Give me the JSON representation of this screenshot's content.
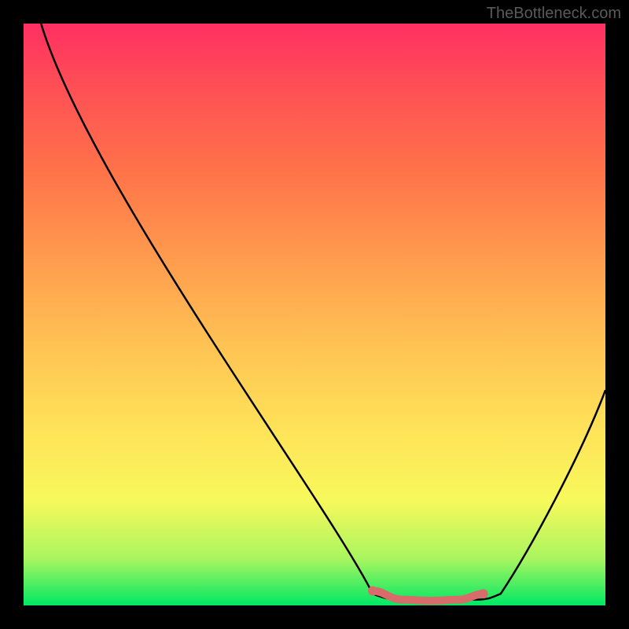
{
  "watermark": "TheBottleneck.com",
  "chart_data": {
    "type": "line",
    "title": "",
    "xlabel": "",
    "ylabel": "",
    "xlim": [
      0,
      1
    ],
    "ylim": [
      0,
      1
    ],
    "series": [
      {
        "name": "main-curve",
        "points": [
          {
            "x": 0.03,
            "y": 1.0
          },
          {
            "x": 0.6,
            "y": 0.02
          },
          {
            "x": 0.65,
            "y": 0.01
          },
          {
            "x": 0.78,
            "y": 0.01
          },
          {
            "x": 0.82,
            "y": 0.02
          },
          {
            "x": 1.0,
            "y": 0.37
          }
        ]
      },
      {
        "name": "highlight-segment",
        "points": [
          {
            "x": 0.6,
            "y": 0.025
          },
          {
            "x": 0.65,
            "y": 0.01
          },
          {
            "x": 0.7,
            "y": 0.008
          },
          {
            "x": 0.75,
            "y": 0.01
          },
          {
            "x": 0.79,
            "y": 0.02
          }
        ]
      }
    ],
    "gradient_colors": {
      "top": "#ff2f62",
      "mid_top": "#ff7249",
      "mid": "#ffe359",
      "mid_bottom": "#a9f55f",
      "bottom": "#00e864"
    },
    "highlight_color": "#d96b6b"
  }
}
